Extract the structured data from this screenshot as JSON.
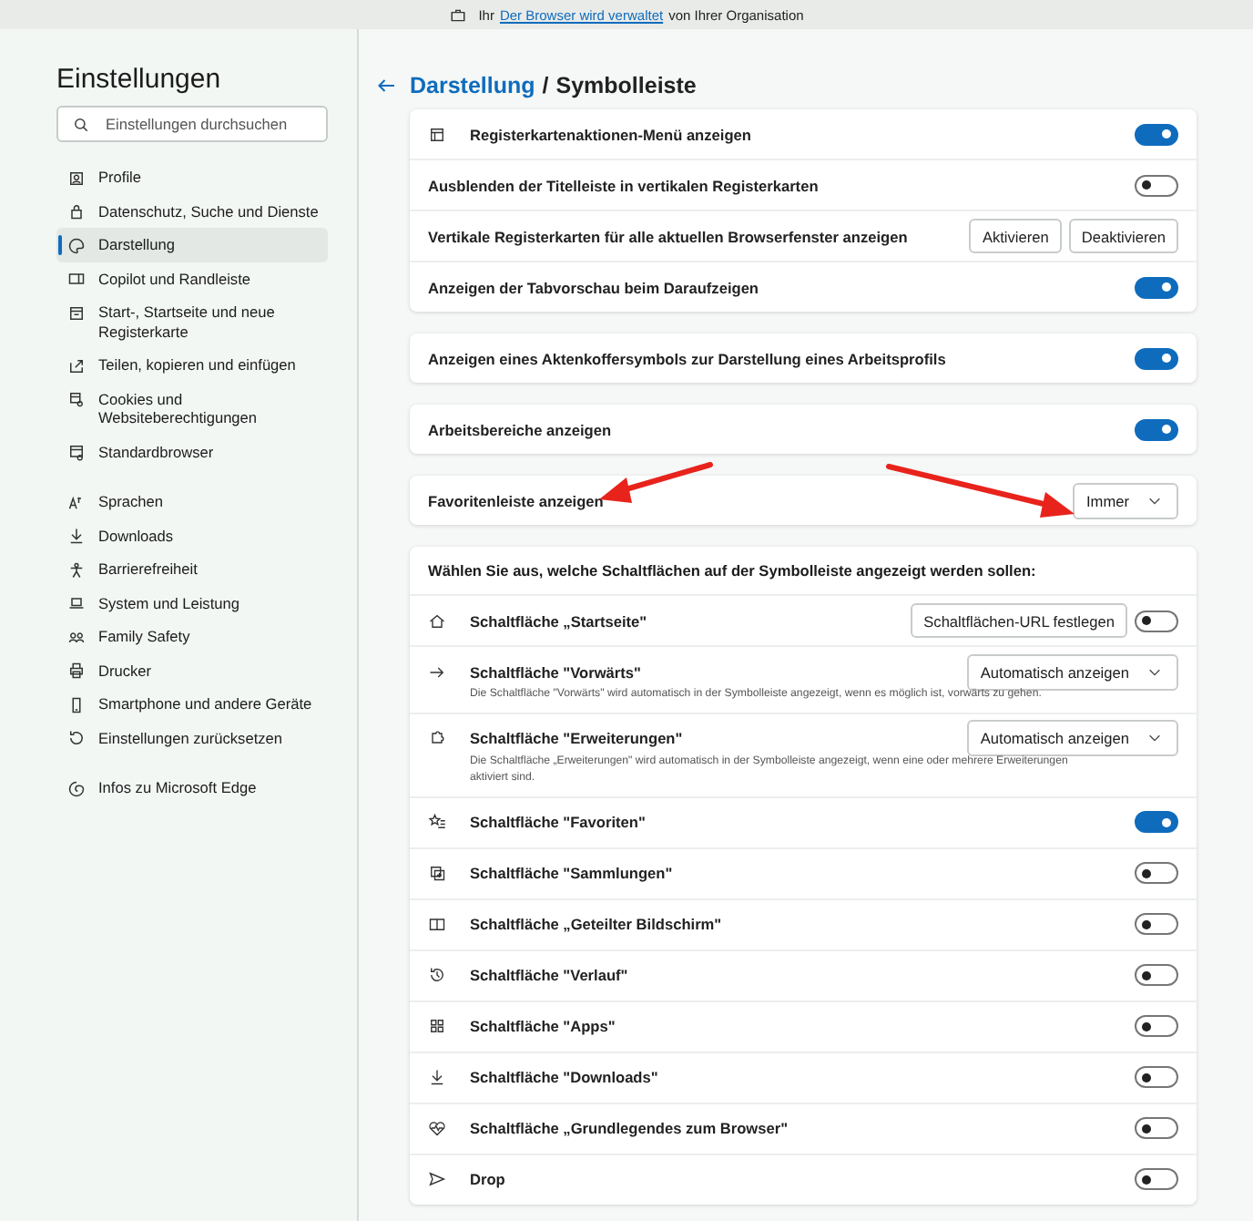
{
  "banner": {
    "prefix": "Ihr",
    "link": "Der Browser wird verwaltet",
    "suffix": "von Ihrer Organisation"
  },
  "sidebar": {
    "title": "Einstellungen",
    "search": {
      "placeholder": "Einstellungen durchsuchen"
    },
    "groups": [
      [
        {
          "label": "Profile",
          "selected": false
        },
        {
          "label": "Datenschutz, Suche und Dienste",
          "selected": false
        },
        {
          "label": "Darstellung",
          "selected": true
        },
        {
          "label": "Copilot und Randleiste",
          "selected": false
        },
        {
          "label": "Start-, Startseite und neue Registerkarte",
          "selected": false
        },
        {
          "label": "Teilen, kopieren und einfügen",
          "selected": false
        },
        {
          "label": "Cookies und Websiteberechtigungen",
          "selected": false
        },
        {
          "label": "Standardbrowser",
          "selected": false
        }
      ],
      [
        {
          "label": "Sprachen",
          "selected": false
        },
        {
          "label": "Downloads",
          "selected": false
        },
        {
          "label": "Barrierefreiheit",
          "selected": false
        },
        {
          "label": "System und Leistung",
          "selected": false
        },
        {
          "label": "Family Safety",
          "selected": false
        },
        {
          "label": "Drucker",
          "selected": false
        },
        {
          "label": "Smartphone und andere Geräte",
          "selected": false
        },
        {
          "label": "Einstellungen zurücksetzen",
          "selected": false
        }
      ],
      [
        {
          "label": "Infos zu Microsoft Edge",
          "selected": false
        }
      ]
    ]
  },
  "breadcrumb": {
    "parent": "Darstellung",
    "separator": "/",
    "current": "Symbolleiste"
  },
  "cards": [
    {
      "rows": [
        {
          "label": "Registerkartenaktionen-Menü anzeigen",
          "kind": "toggle",
          "on": true
        },
        {
          "label": "Ausblenden der Titelleiste in vertikalen Registerkarten",
          "kind": "toggle",
          "on": false
        },
        {
          "label": "Vertikale Registerkarten für alle aktuellen Browserfenster anzeigen",
          "kind": "buttons",
          "buttons": [
            "Aktivieren",
            "Deaktivieren"
          ]
        },
        {
          "label": "Anzeigen der Tabvorschau beim Daraufzeigen",
          "kind": "toggle",
          "on": true
        }
      ]
    },
    {
      "rows": [
        {
          "label": "Anzeigen eines Aktenkoffersymbols zur Darstellung eines Arbeitsprofils",
          "kind": "toggle",
          "on": true
        }
      ]
    },
    {
      "rows": [
        {
          "label": "Arbeitsbereiche anzeigen",
          "kind": "toggle",
          "on": true
        }
      ]
    },
    {
      "rows": [
        {
          "label": "Favoritenleiste anzeigen",
          "kind": "dropdown",
          "value": "Immer"
        }
      ]
    },
    {
      "header": "Wählen Sie aus, welche Schaltflächen auf der Symbolleiste angezeigt werden sollen:",
      "rows": [
        {
          "label": "Schaltfläche „Startseite\"",
          "kind": "button_toggle",
          "button": "Schaltflächen-URL festlegen",
          "on": false
        },
        {
          "label": "Schaltfläche \"Vorwärts\"",
          "kind": "dropdown",
          "value": "Automatisch anzeigen",
          "description": "Die Schaltfläche \"Vorwärts\" wird automatisch in der Symbolleiste angezeigt, wenn es möglich ist, vorwärts zu gehen."
        },
        {
          "label": "Schaltfläche \"Erweiterungen\"",
          "kind": "dropdown",
          "value": "Automatisch anzeigen",
          "description": "Die Schaltfläche „Erweiterungen\" wird automatisch in der Symbolleiste angezeigt, wenn eine oder mehrere Erweiterungen aktiviert sind."
        },
        {
          "label": "Schaltfläche \"Favoriten\"",
          "kind": "toggle",
          "on": true
        },
        {
          "label": "Schaltfläche \"Sammlungen\"",
          "kind": "toggle",
          "on": false
        },
        {
          "label": "Schaltfläche „Geteilter Bildschirm\"",
          "kind": "toggle",
          "on": false
        },
        {
          "label": "Schaltfläche \"Verlauf\"",
          "kind": "toggle",
          "on": false
        },
        {
          "label": "Schaltfläche \"Apps\"",
          "kind": "toggle",
          "on": false
        },
        {
          "label": "Schaltfläche \"Downloads\"",
          "kind": "toggle",
          "on": false
        },
        {
          "label": "Schaltfläche „Grundlegendes zum Browser\"",
          "kind": "toggle",
          "on": false
        },
        {
          "label": "Drop",
          "kind": "toggle",
          "on": false
        }
      ]
    }
  ]
}
